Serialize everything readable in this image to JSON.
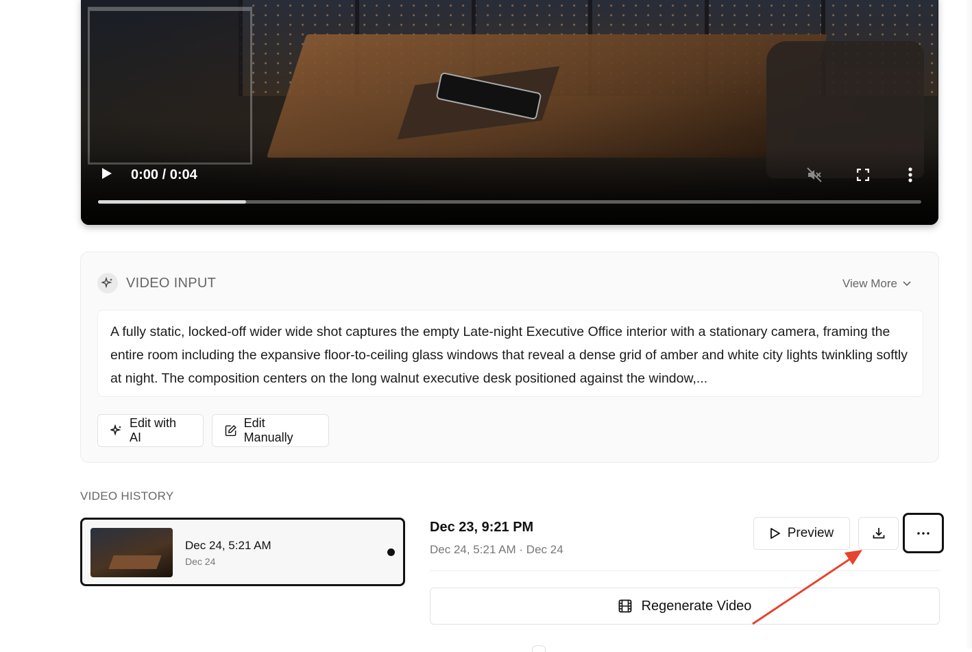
{
  "video": {
    "time_display": "0:00 / 0:04",
    "progress_fraction": 0.18,
    "icons": [
      "play-icon",
      "muted-volume-icon",
      "fullscreen-icon",
      "more-vertical-icon"
    ]
  },
  "video_input": {
    "title": "VIDEO INPUT",
    "view_more_label": "View More",
    "prompt_text": "A fully static, locked-off wider wide shot captures the empty Late-night Executive Office interior with a stationary camera, framing the entire room including the expansive floor-to-ceiling glass windows that reveal a dense grid of amber and white city lights twinkling softly at night. The composition centers on the long walnut executive desk positioned against the window,...",
    "edit_ai_label": "Edit with AI",
    "edit_manual_label": "Edit Manually"
  },
  "history": {
    "title": "VIDEO HISTORY",
    "items": [
      {
        "date": "Dec 24, 5:21 AM",
        "sub": "Dec 24"
      }
    ]
  },
  "detail": {
    "date": "Dec 23, 9:21 PM",
    "sub": "Dec 24, 5:21 AM · Dec 24",
    "preview_label": "Preview",
    "regenerate_label": "Regenerate Video"
  },
  "colors": {
    "annotation_arrow": "#e8432e",
    "selected_border": "#111111"
  }
}
